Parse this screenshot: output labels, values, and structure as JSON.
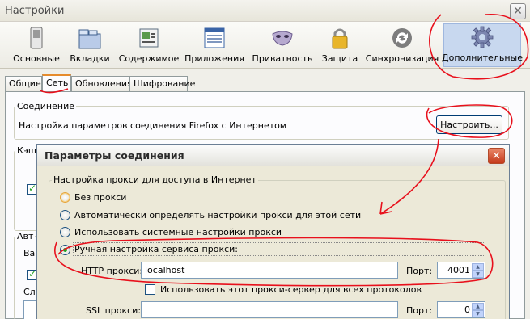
{
  "main": {
    "title": "Настройки",
    "close_glyph": "✕",
    "toolbar": [
      {
        "label": "Основные",
        "icon": "switch-icon"
      },
      {
        "label": "Вкладки",
        "icon": "tabs-icon"
      },
      {
        "label": "Содержимое",
        "icon": "content-icon"
      },
      {
        "label": "Приложения",
        "icon": "applications-icon"
      },
      {
        "label": "Приватность",
        "icon": "privacy-mask-icon"
      },
      {
        "label": "Защита",
        "icon": "padlock-icon"
      },
      {
        "label": "Синхронизация",
        "icon": "sync-icon"
      },
      {
        "label": "Дополнительные",
        "icon": "gear-icon",
        "selected": true
      }
    ],
    "subtabs": [
      "Общие",
      "Сеть",
      "Обновления",
      "Шифрование"
    ],
    "active_subtab": "Сеть",
    "connection": {
      "group_label": "Соединение",
      "description": "Настройка параметров соединения Firefox с Интернетом",
      "button_label": "Настроить..."
    },
    "cache_label_fragment": "Кэш",
    "offline_label_fragment": "Авт",
    "offline_fragment_2": "Ваш",
    "offline_fragment_3": "Сле"
  },
  "dialog": {
    "title": "Параметры соединения",
    "close_glyph": "✕",
    "proxy_group_label": "Настройка прокси для доступа в Интернет",
    "options": [
      {
        "label": "Без прокси",
        "checked": false
      },
      {
        "label": "Автоматически определять настройки прокси для этой сети",
        "checked": false
      },
      {
        "label": "Использовать системные настройки прокси",
        "checked": false
      },
      {
        "label": "Ручная настройка сервиса прокси:",
        "checked": true
      }
    ],
    "http_label": "HTTP прокси:",
    "http_value": "localhost",
    "port_label": "Порт:",
    "http_port": "4001",
    "use_all_label": "Использовать этот прокси-сервер для всех протоколов",
    "ssl_label": "SSL прокси:",
    "ssl_value": "",
    "ssl_port_label": "Порт:",
    "ssl_port": "0"
  },
  "annotation_color": "#e8101c",
  "accent_color": "#e68b2c"
}
